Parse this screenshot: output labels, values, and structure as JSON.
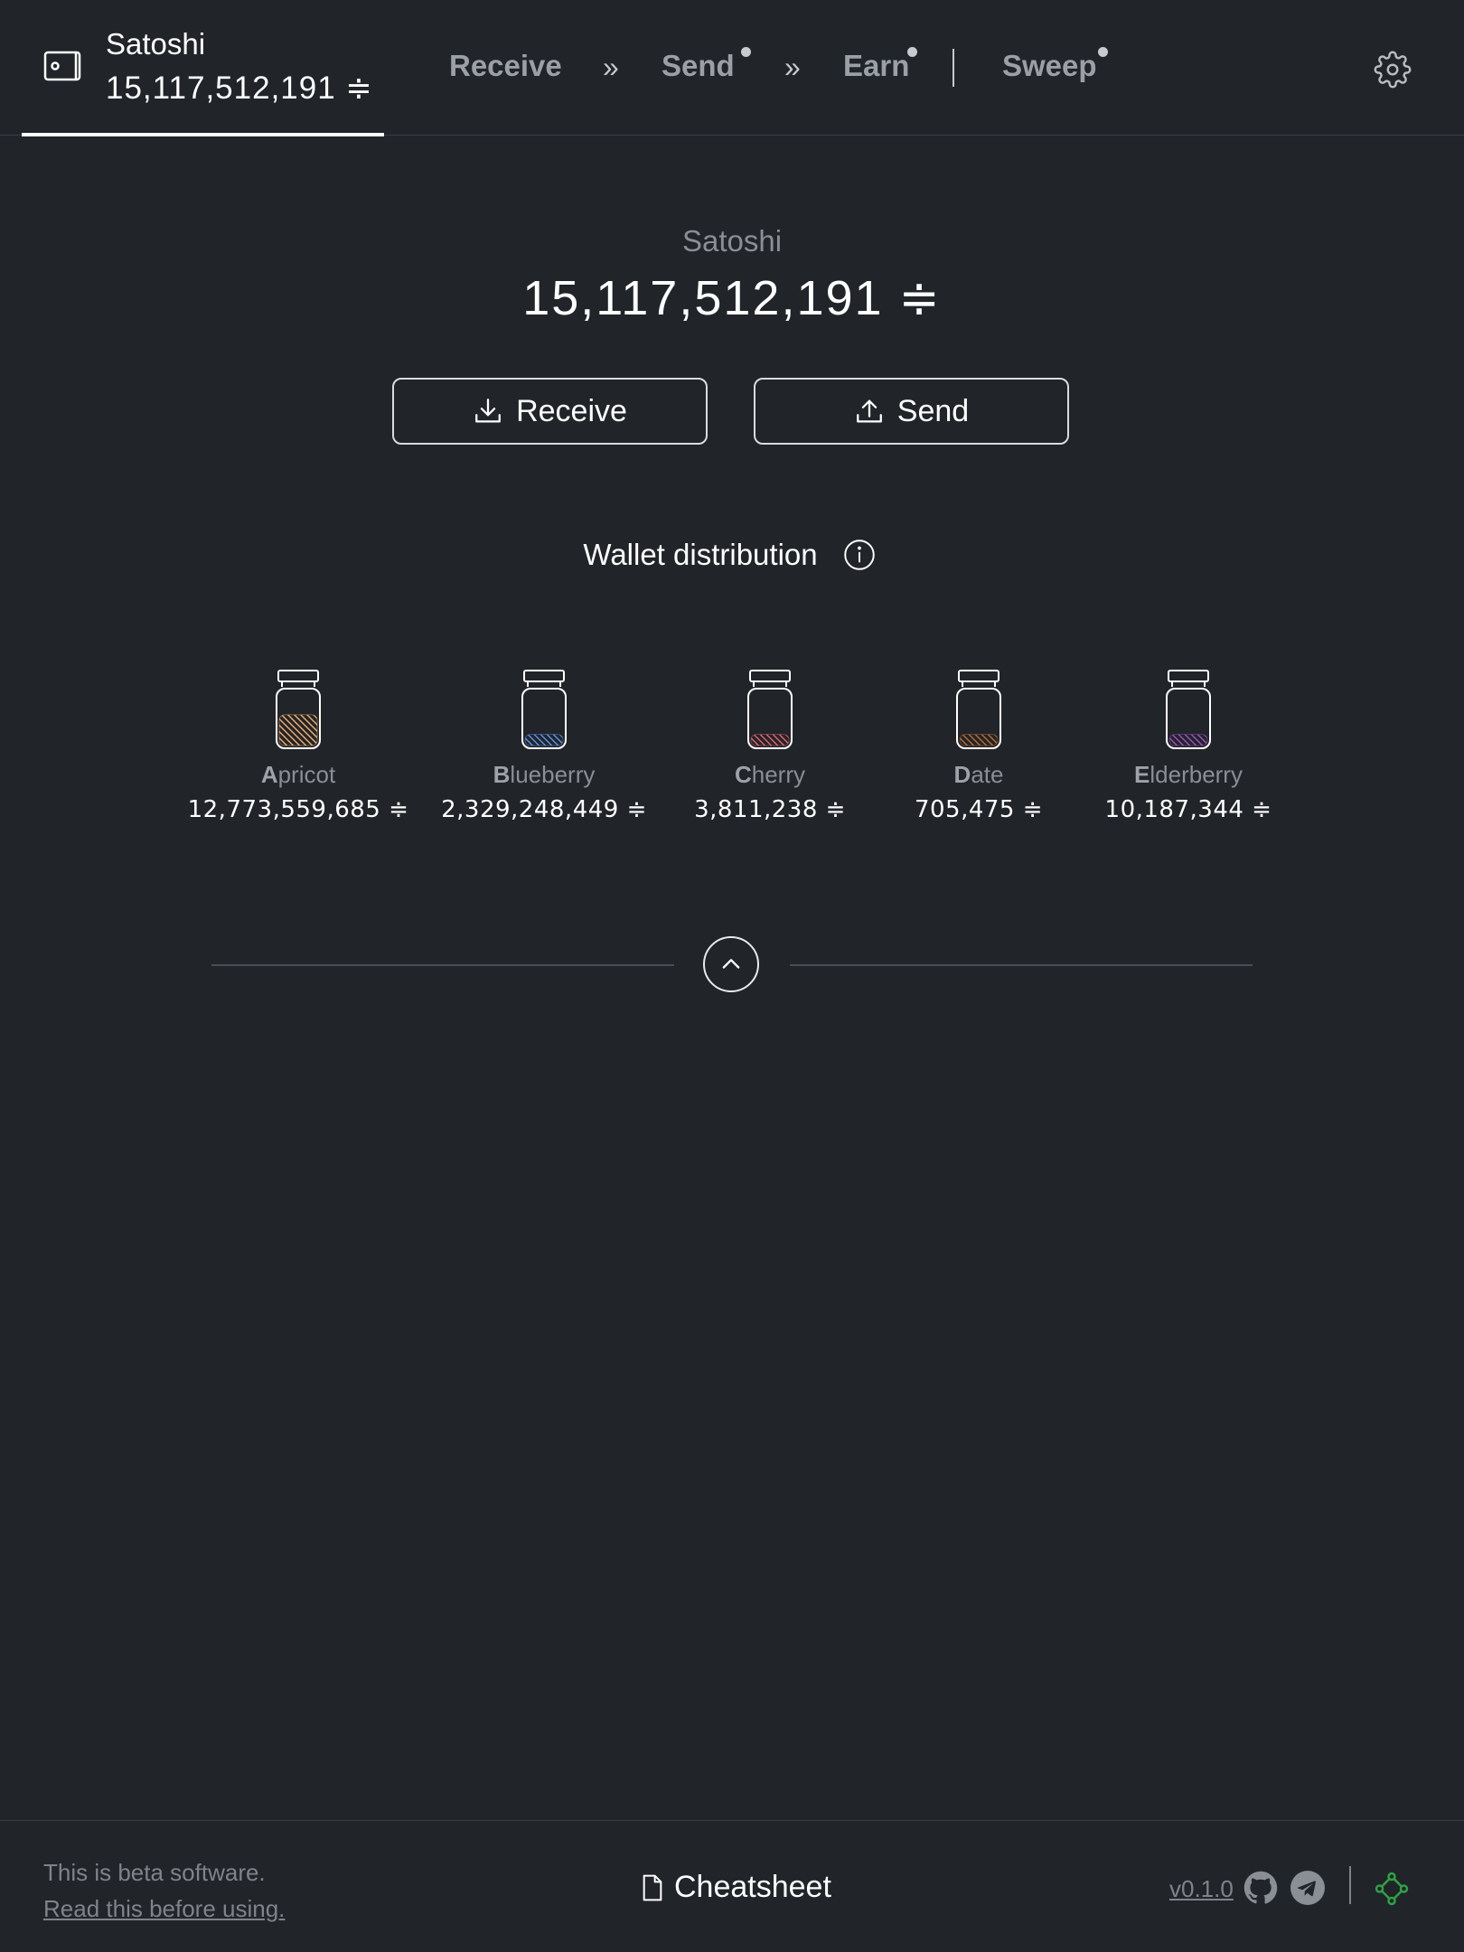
{
  "header": {
    "wallet_name": "Satoshi",
    "wallet_balance": "15,117,512,191 ≑",
    "nav": {
      "receive": "Receive",
      "sep1": "»",
      "send": "Send",
      "sep2": "»",
      "earn": "Earn",
      "sweep": "Sweep"
    }
  },
  "balance": {
    "label": "Satoshi",
    "value": "15,117,512,191 ≑"
  },
  "actions": {
    "receive_label": "Receive",
    "send_label": "Send"
  },
  "distribution": {
    "title": "Wallet distribution",
    "jars": [
      {
        "initial": "A",
        "rest": "pricot",
        "amount": "12,773,559,685 ≑",
        "color": "#e9a86a",
        "fill": 0.55
      },
      {
        "initial": "B",
        "rest": "lueberry",
        "amount": "2,329,248,449 ≑",
        "color": "#5c8fe6",
        "fill": 0.2
      },
      {
        "initial": "C",
        "rest": "herry",
        "amount": "3,811,238 ≑",
        "color": "#e0616a",
        "fill": 0.2
      },
      {
        "initial": "D",
        "rest": "ate",
        "amount": "705,475 ≑",
        "color": "#b86a2c",
        "fill": 0.2
      },
      {
        "initial": "E",
        "rest": "lderberry",
        "amount": "10,187,344 ≑",
        "color": "#9b4fc0",
        "fill": 0.2
      }
    ]
  },
  "footer": {
    "beta_text": "This is beta software.",
    "beta_link": "Read this before using.",
    "cheatsheet": "Cheatsheet",
    "version": "v0.1.0"
  },
  "colors": {
    "background": "#212429",
    "muted_text": "#8a8e95",
    "accent_green": "#2ea043"
  }
}
